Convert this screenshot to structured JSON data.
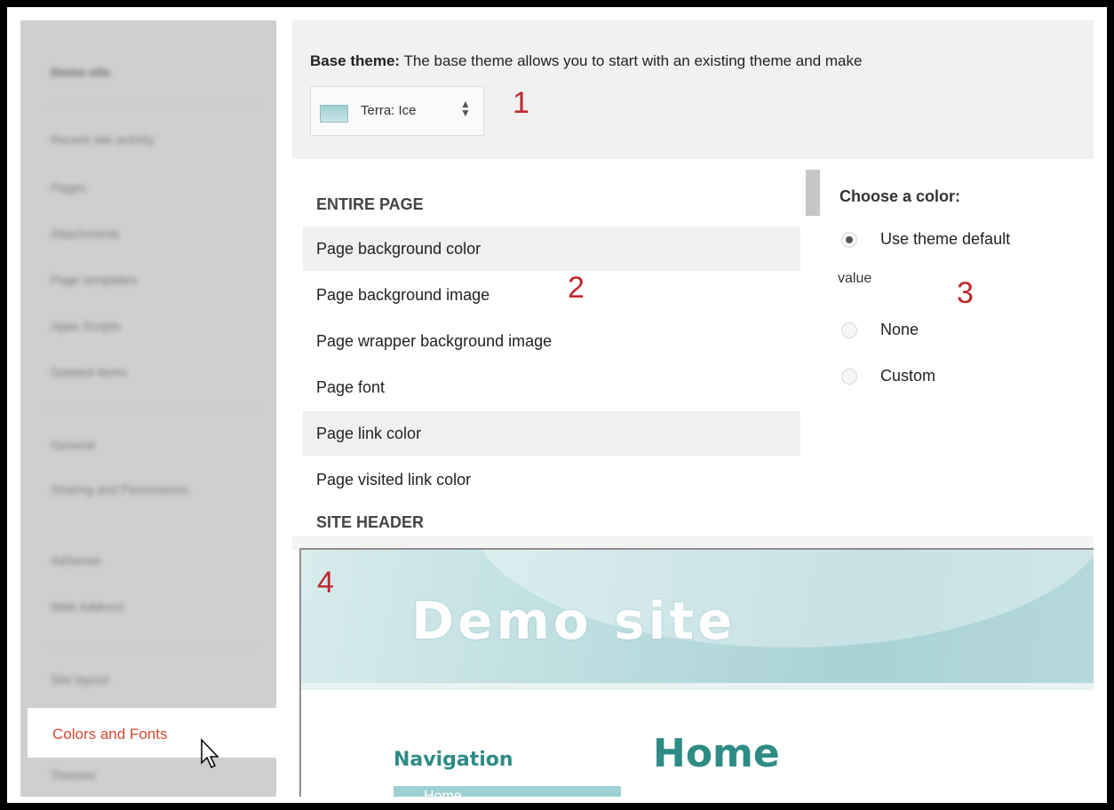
{
  "sidebar": {
    "title": "Demo site",
    "items_top": [
      "Recent site activity",
      "Pages",
      "Attachments",
      "Page templates",
      "Apps Scripts",
      "Deleted items"
    ],
    "items_mid": [
      "General",
      "Sharing and Permissions",
      "AdSense",
      "Web Address"
    ],
    "items_bottom": [
      "Site layout"
    ],
    "active": "Colors and Fonts",
    "items_after": [
      "Themes"
    ]
  },
  "base_theme": {
    "label": "Base theme:",
    "description": " The base theme allows you to start with an existing theme and make",
    "selected": "Terra: Ice"
  },
  "annotations": [
    "1",
    "2",
    "3",
    "4"
  ],
  "list": {
    "section1": "ENTIRE PAGE",
    "items": [
      "Page background color",
      "Page background image",
      "Page wrapper background image",
      "Page font",
      "Page link color",
      "Page visited link color"
    ],
    "section2": "SITE HEADER"
  },
  "chooser": {
    "title": "Choose a color:",
    "options": [
      "Use theme default",
      "None",
      "Custom"
    ],
    "option1_cont": "value",
    "selected": "Use theme default"
  },
  "preview": {
    "site_title": "Demo site",
    "nav_title": "Navigation",
    "page_title": "Home",
    "nav_item": "Home"
  },
  "colors": {
    "active_link": "#d14836",
    "annotation": "#c0282d",
    "preview_accent": "#2e8b86"
  }
}
